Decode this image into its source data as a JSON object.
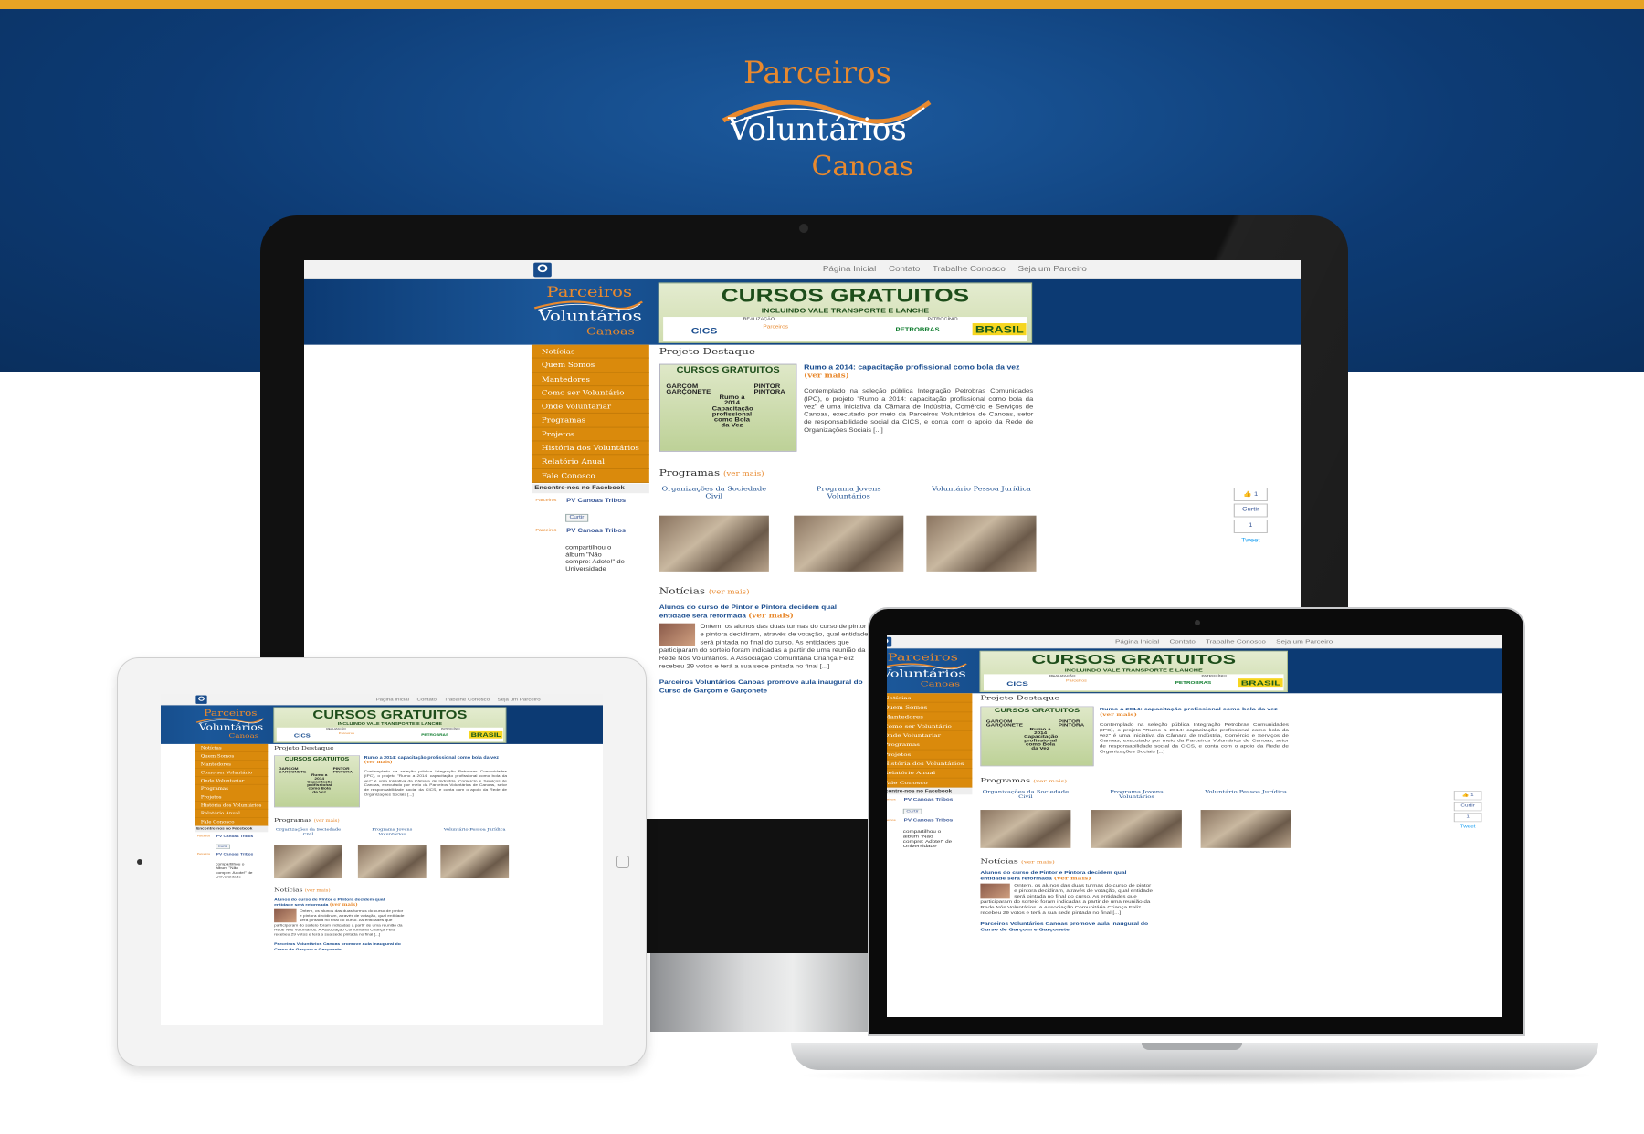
{
  "brand": {
    "line1": "Parceiros",
    "line2": "Voluntários",
    "line3": "Canoas"
  },
  "colors": {
    "brand_orange": "#e8892e",
    "brand_blue": "#0d3b74",
    "menu_orange": "#da8a0c",
    "top_stripe": "#e7a324"
  },
  "site": {
    "search_icon": "search-icon",
    "nav": [
      "Página Inicial",
      "Contato",
      "Trabalhe Conosco",
      "Seja um Parceiro"
    ],
    "banner": {
      "title": "CURSOS GRATUITOS",
      "subtitle": "INCLUINDO VALE TRANSPORTE E LANCHE",
      "realizacao": "REALIZAÇÃO",
      "patrocinio": "PATROCÍNIO",
      "cics": "CICS",
      "petrobras": "PETROBRAS",
      "brasil": "BRASIL"
    },
    "menu": [
      "Notícias",
      "Quem Somos",
      "Mantedores",
      "Como ser Voluntário",
      "Onde Voluntariar",
      "Programas",
      "Projetos",
      "História dos Voluntários",
      "Relatório Anual",
      "Fale Conosco"
    ],
    "facebook": {
      "heading": "Encontre-nos no Facebook",
      "page_name": "PV Canoas Tribos",
      "like": "Curtir",
      "post_author": "PV Canoas Tribos",
      "post_text": "compartilhou o álbum \"Não compre: Adote!\" de Universidade"
    },
    "featured": {
      "heading": "Projeto Destaque",
      "img_title": "CURSOS GRATUITOS",
      "img_left": "GARÇOM GARÇONETE",
      "img_right": "PINTOR PINTORA",
      "img_center": "Rumo a 2014 Capacitação profissional como Bola da Vez",
      "title": "Rumo a 2014: capacitação profissional como bola da vez",
      "more": "(ver mais)",
      "body": "Contemplado na seleção pública Integração Petrobras Comunidades (IPC), o projeto \"Rumo a 2014: capacitação profissional como bola da vez\" é uma iniciativa da Câmara de Indústria, Comércio e Serviços de Canoas, executado por meio da Parceiros Voluntários de Canoas, setor de responsabilidade social da CICS, e conta com o apoio da Rede de Organizações Sociais [...]"
    },
    "programs": {
      "heading": "Programas",
      "more": "(ver mais)",
      "items": [
        "Organizações da Sociedade Civil",
        "Programa Jovens Voluntários",
        "Voluntário Pessoa Jurídica"
      ]
    },
    "social": {
      "likes": "1",
      "share": "Curtir",
      "tweets": "1",
      "tweet": "Tweet"
    },
    "news": {
      "heading": "Notícias",
      "more": "(ver mais)",
      "item1_title": "Alunos do curso de Pintor e Pintora decidem qual entidade será reformada",
      "item1_more": "(ver mais)",
      "item1_body": "Ontem, os alunos das duas turmas do curso de pintor e pintora decidiram, através de votação, qual entidade será pintada no final do curso. As entidades que participaram do sorteio foram indicadas a partir de uma reunião da Rede Nós Voluntários. A Associação Comunitária Criança Feliz recebeu 29 votos e terá a sua sede pintada no final [...]",
      "item2_title": "Parceiros Voluntários Canoas promove aula inaugural do Curso de Garçom e Garçonete"
    }
  }
}
